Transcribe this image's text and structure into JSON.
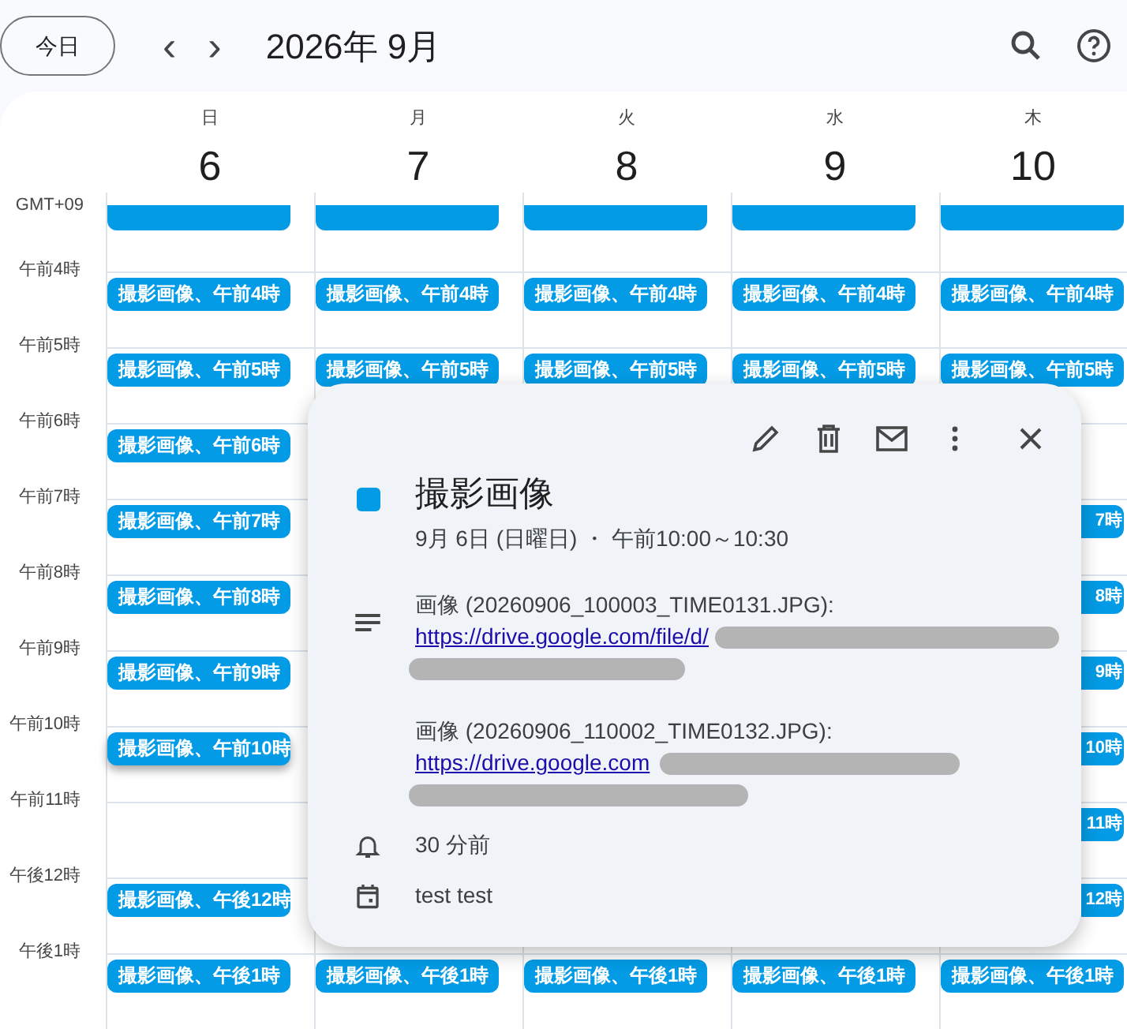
{
  "toolbar": {
    "today_button": "今日",
    "prev": "‹",
    "next": "›",
    "title": "2026年 9月"
  },
  "days": [
    {
      "weekday": "日",
      "date": "6"
    },
    {
      "weekday": "月",
      "date": "7"
    },
    {
      "weekday": "火",
      "date": "8"
    },
    {
      "weekday": "水",
      "date": "9"
    },
    {
      "weekday": "木",
      "date": "10"
    }
  ],
  "timezone": "GMT+09",
  "rows": [
    {
      "cells": [
        {
          "kind": "clipped",
          "selected": false
        },
        {
          "kind": "clipped",
          "selected": false
        },
        {
          "kind": "clipped",
          "selected": false
        },
        {
          "kind": "clipped",
          "selected": false
        },
        {
          "kind": "clipped",
          "selected": false
        }
      ]
    },
    {
      "hour": "午前4時",
      "cells": [
        {
          "kind": "full",
          "text": "撮影画像、午前4時",
          "selected": false
        },
        {
          "kind": "full",
          "text": "撮影画像、午前4時",
          "selected": false
        },
        {
          "kind": "full",
          "text": "撮影画像、午前4時",
          "selected": false
        },
        {
          "kind": "full",
          "text": "撮影画像、午前4時",
          "selected": false
        },
        {
          "kind": "full",
          "text": "撮影画像、午前4時",
          "selected": false
        }
      ]
    },
    {
      "hour": "午前5時",
      "cells": [
        {
          "kind": "full",
          "text": "撮影画像、午前5時",
          "selected": false
        },
        {
          "kind": "full",
          "text": "撮影画像、午前5時",
          "selected": false
        },
        {
          "kind": "full",
          "text": "撮影画像、午前5時",
          "selected": false
        },
        {
          "kind": "full",
          "text": "撮影画像、午前5時",
          "selected": false
        },
        {
          "kind": "full",
          "text": "撮影画像、午前5時",
          "selected": false
        }
      ]
    },
    {
      "hour": "午前6時",
      "cells": [
        {
          "kind": "full",
          "text": "撮影画像、午前6時",
          "selected": false
        },
        null,
        null,
        null,
        null
      ]
    },
    {
      "hour": "午前7時",
      "cells": [
        {
          "kind": "full",
          "text": "撮影画像、午前7時",
          "selected": false
        },
        null,
        null,
        null,
        {
          "kind": "partial",
          "text": "7時",
          "selected": false
        }
      ]
    },
    {
      "hour": "午前8時",
      "cells": [
        {
          "kind": "full",
          "text": "撮影画像、午前8時",
          "selected": false
        },
        null,
        null,
        null,
        {
          "kind": "partial",
          "text": "8時",
          "selected": false
        }
      ]
    },
    {
      "hour": "午前9時",
      "cells": [
        {
          "kind": "full",
          "text": "撮影画像、午前9時",
          "selected": false
        },
        null,
        null,
        null,
        {
          "kind": "partial",
          "text": "9時",
          "selected": false
        }
      ]
    },
    {
      "hour": "午前10時",
      "cells": [
        {
          "kind": "full",
          "text": "撮影画像、午前10時",
          "selected": true
        },
        null,
        null,
        null,
        {
          "kind": "partial",
          "text": "10時",
          "selected": false
        }
      ]
    },
    {
      "hour": "午前11時",
      "cells": [
        null,
        null,
        null,
        null,
        {
          "kind": "partial",
          "text": "11時",
          "selected": false
        }
      ]
    },
    {
      "hour": "午後12時",
      "cells": [
        {
          "kind": "full",
          "text": "撮影画像、午後12時",
          "selected": false
        },
        null,
        null,
        null,
        {
          "kind": "partial",
          "text": "12時",
          "selected": false
        }
      ]
    },
    {
      "hour": "午後1時",
      "cells": [
        {
          "kind": "full",
          "text": "撮影画像、午後1時",
          "selected": false
        },
        {
          "kind": "full",
          "text": "撮影画像、午後1時",
          "selected": false
        },
        {
          "kind": "full",
          "text": "撮影画像、午後1時",
          "selected": false
        },
        {
          "kind": "full",
          "text": "撮影画像、午後1時",
          "selected": false
        },
        {
          "kind": "full",
          "text": "撮影画像、午後1時",
          "selected": false
        }
      ]
    }
  ],
  "popup": {
    "title": "撮影画像",
    "color": "#039be5",
    "when": "9月 6日 (日曜日) ・ 午前10:00～10:30",
    "description": [
      {
        "label": "画像 (20260906_100003_TIME0131.JPG):",
        "link": "https://drive.google.com/file/d/"
      },
      {
        "label": "画像 (20260906_110002_TIME0132.JPG):",
        "link": "https://drive.google.com"
      }
    ],
    "reminder": "30 分前",
    "calendar": "test test"
  }
}
